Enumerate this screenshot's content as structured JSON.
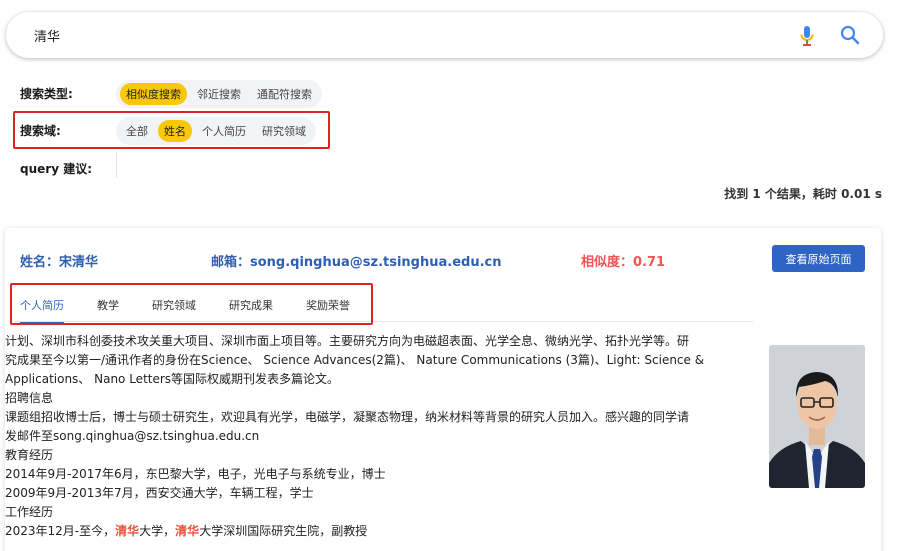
{
  "search": {
    "query": "清华"
  },
  "filters": {
    "search_type": {
      "label": "搜索类型:",
      "options": [
        "相似度搜索",
        "邻近搜索",
        "通配符搜索"
      ],
      "active": "相似度搜索"
    },
    "search_field": {
      "label": "搜索域:",
      "options": [
        "全部",
        "姓名",
        "个人简历",
        "研究领域"
      ],
      "active": "姓名"
    },
    "query_suggestion": {
      "label": "query 建议:"
    }
  },
  "result_summary": "找到 1 个结果，耗时 0.01 s",
  "result": {
    "name": "姓名：宋清华",
    "email": "邮箱：song.qinghua@sz.tsinghua.edu.cn",
    "similarity": "相似度：0.71",
    "view_button": "查看原始页面",
    "tabs": [
      "个人简历",
      "教学",
      "研究领域",
      "研究成果",
      "奖励荣誉"
    ],
    "active_tab": "个人简历",
    "content_lines": [
      "计划、深圳市科创委技术攻关重大项目、深圳市面上项目等。主要研究方向为电磁超表面、光学全息、微纳光学、拓扑光学等。研",
      "究成果至今以第一/通讯作者的身份在Science、 Science Advances(2篇)、 Nature Communications (3篇)、Light: Science &",
      "Applications、 Nano Letters等国际权威期刊发表多篇论文。",
      "招聘信息",
      "课题组招收博士后，博士与硕士研究生，欢迎具有光学，电磁学，凝聚态物理，纳米材料等背景的研究人员加入。感兴趣的同学请",
      "发邮件至song.qinghua@sz.tsinghua.edu.cn",
      "教育经历",
      "2014年9月-2017年6月，东巴黎大学，电子，光电子与系统专业，博士",
      "2009年9月-2013年7月，西安交通大学，车辆工程，学士",
      "工作经历"
    ],
    "last_line": {
      "prefix": "2023年12月-至今，",
      "hl1": "清华",
      "mid": "大学，",
      "hl2": "清华",
      "suffix": "大学深圳国际研究生院，副教授"
    }
  },
  "colors": {
    "accent": "#2f64c4",
    "chip_active": "#f9c70b",
    "highlight": "#e8543d",
    "annotation_box": "#e02424"
  }
}
